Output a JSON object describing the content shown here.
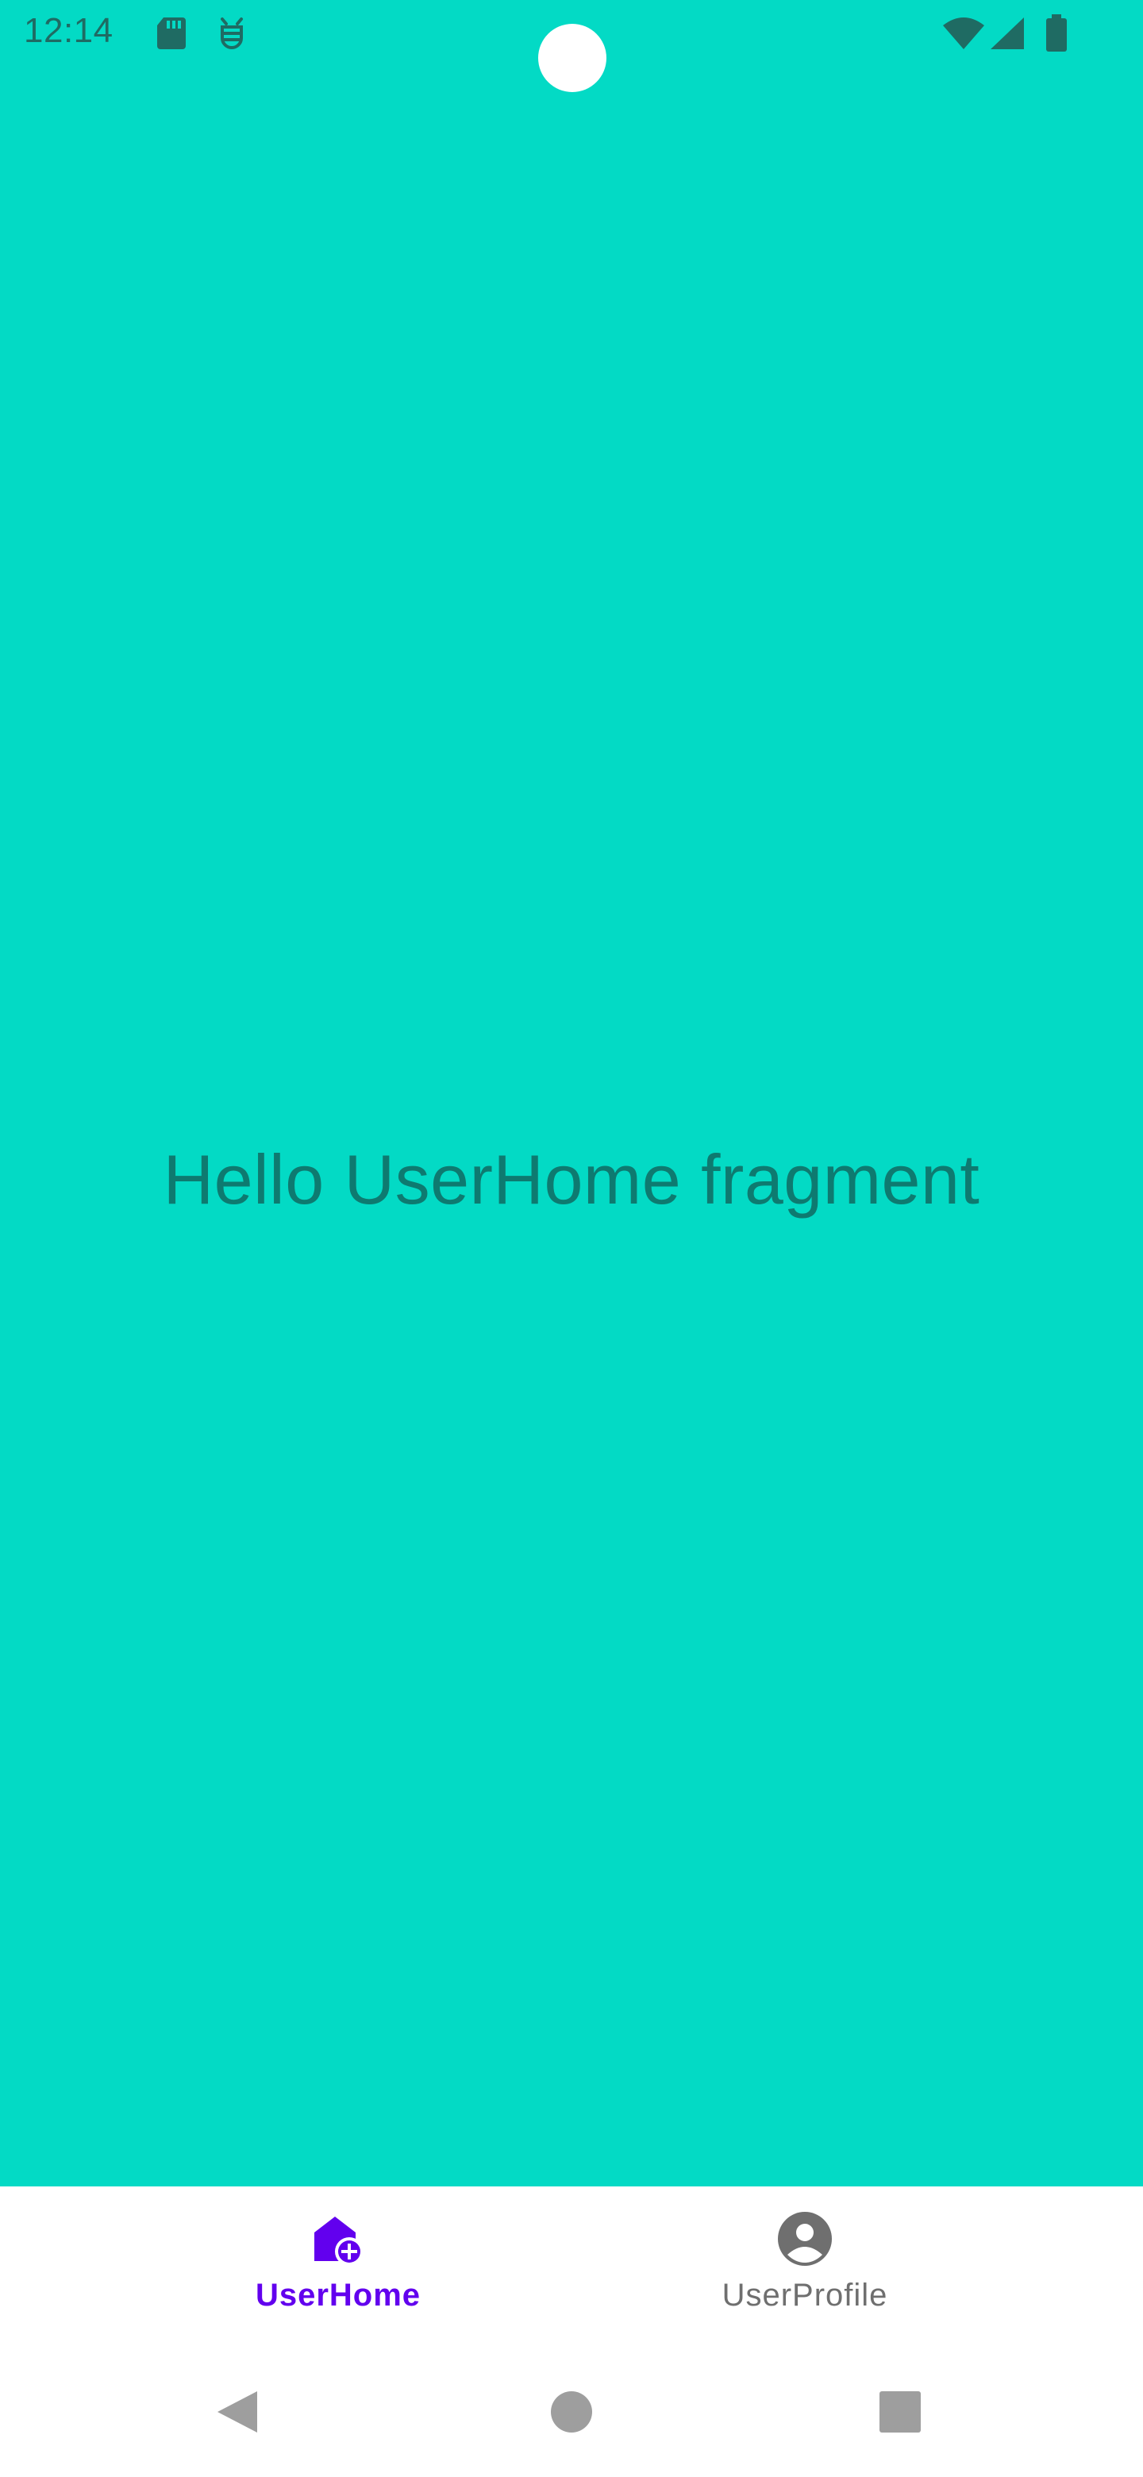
{
  "status_bar": {
    "time": "12:14",
    "icons": [
      "sd-card-icon",
      "bug-icon",
      "wifi-icon",
      "signal-icon",
      "battery-icon"
    ]
  },
  "main": {
    "message": "Hello UserHome fragment",
    "background_color": "#03DAC5"
  },
  "bottom_nav": {
    "items": [
      {
        "label": "UserHome",
        "icon": "home-add-icon",
        "selected": true,
        "color": "#6200EE"
      },
      {
        "label": "UserProfile",
        "icon": "account-circle-icon",
        "selected": false,
        "color": "#6F6F6F"
      }
    ]
  },
  "system_nav": {
    "buttons": [
      "back-triangle-icon",
      "home-circle-icon",
      "recents-square-icon"
    ]
  }
}
